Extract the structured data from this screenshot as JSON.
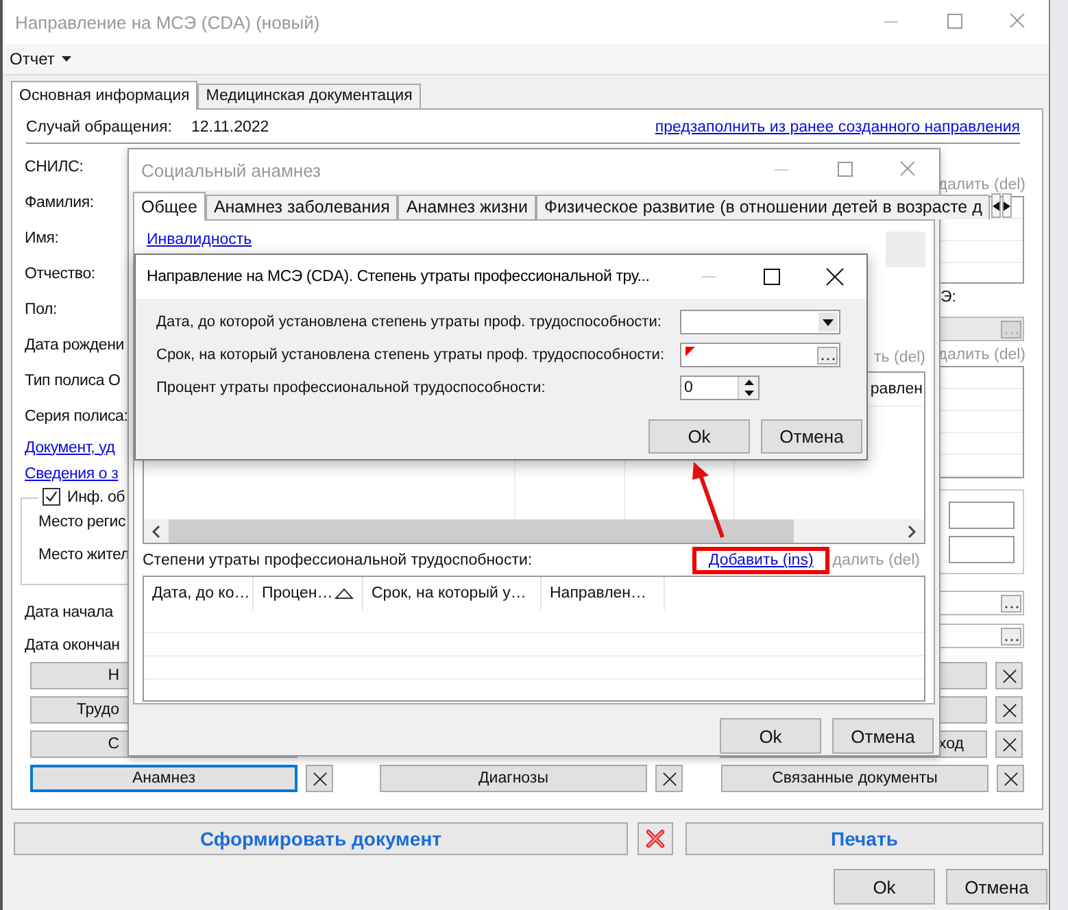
{
  "main_window": {
    "title": "Направление на МСЭ (CDA) (новый)",
    "active": false,
    "menu": [
      {
        "label": "Отчет"
      }
    ],
    "tabs": [
      {
        "label": "Основная информация",
        "selected": true
      },
      {
        "label": "Медицинская документация",
        "selected": false
      }
    ],
    "case": {
      "label": "Случай обращения:",
      "value": "12.11.2022"
    },
    "prefill_link": "предзаполнить из ранее созданного направления",
    "field_labels": [
      "СНИЛС:",
      "Фамилия:",
      "Имя:",
      "Отчество:",
      "Пол:",
      "Дата рождени",
      "Тип полиса О",
      "Серия полиса:"
    ],
    "links": [
      "Документ, уд",
      "Сведения о з"
    ],
    "address_group": {
      "checkbox": {
        "label": "Инф. об",
        "checked": true
      },
      "labels": [
        "Место регис",
        "Место жител"
      ]
    },
    "date_labels": [
      "Дата начала",
      "Дата окончан"
    ],
    "side_panel": {
      "delete_links": [
        "далить (del)",
        "далить (del)"
      ],
      "label": "Э:"
    },
    "section_rows": [
      {
        "left": "Н"
      },
      {
        "left": "Трудо"
      },
      {
        "left": "С",
        "right": "ход"
      }
    ],
    "section_buttons": [
      {
        "label": "Анамнез",
        "focused": true
      },
      {
        "label": "Диагнозы",
        "focused": false
      },
      {
        "label": "Связанные документы",
        "focused": false
      }
    ],
    "generate_button": "Сформировать документ",
    "print_button": "Печать",
    "buttons": [
      "Ok",
      "Отмена"
    ]
  },
  "social_dialog": {
    "title": "Социальный анамнез",
    "active": false,
    "tabs": [
      {
        "label": "Общее",
        "selected": true
      },
      {
        "label": "Анамнез заболевания",
        "selected": false
      },
      {
        "label": "Анамнез жизни",
        "selected": false
      },
      {
        "label": "Физическое развитие (в отношении детей в возрасте д",
        "selected": false
      }
    ],
    "disability_link": "Инвалидность",
    "upper_delete": "ть (del)",
    "upper_table": {
      "columns": [
        "равлен"
      ]
    },
    "section_label": "Степени утраты профессиональной трудоспобности:",
    "add_link": "Добавить (ins)",
    "delete_link": "далить (del)",
    "table": {
      "columns": [
        {
          "label": "Дата, до ко…",
          "sorted": false
        },
        {
          "label": "Процен…",
          "sorted": true
        },
        {
          "label": "Срок, на который у…",
          "sorted": false
        },
        {
          "label": "Направлен…",
          "sorted": false
        }
      ]
    },
    "buttons": [
      "Ok",
      "Отмена"
    ]
  },
  "degree_dialog": {
    "title": "Направление на МСЭ (CDA). Степень утраты профессиональной тру...",
    "active": true,
    "fields": [
      {
        "kind": "combo",
        "label": "Дата, до которой установлена степень утраты проф. трудоспособности:"
      },
      {
        "kind": "date",
        "label": "Срок, на который установлена степень утраты проф. трудоспособности:",
        "invalid": true
      },
      {
        "kind": "spin",
        "label": "Процент утраты профессиональной трудоспособности:",
        "value": "0"
      }
    ],
    "buttons": [
      "Ok",
      "Отмена"
    ]
  }
}
